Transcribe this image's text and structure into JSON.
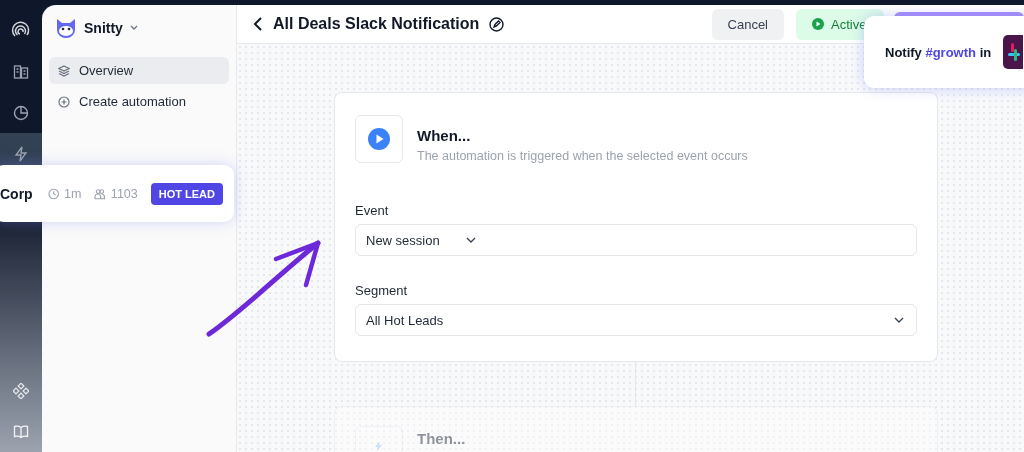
{
  "rail": [
    {
      "kind": "logo",
      "selected": false
    },
    {
      "kind": "building",
      "selected": false
    },
    {
      "kind": "pie",
      "selected": false
    },
    {
      "kind": "bolt",
      "selected": true
    },
    {
      "kind": "nodes",
      "selected": false
    },
    {
      "kind": "book",
      "selected": false
    }
  ],
  "sidebar": {
    "workspace": "Snitty",
    "items": [
      {
        "label": "Overview",
        "selected": true
      },
      {
        "label": "Create automation",
        "selected": false
      }
    ]
  },
  "header": {
    "title": "All Deals Slack Notification",
    "buttons": [
      {
        "kind": "cancel",
        "label": "Cancel"
      },
      {
        "kind": "active",
        "label": "Active"
      }
    ]
  },
  "trigger": {
    "title": "When...",
    "subtitle": "The automation is triggered when the selected event occurs",
    "fields": [
      {
        "label": "Event",
        "value": "New session",
        "kind": "short"
      },
      {
        "label": "Segment",
        "value": "All Hot Leads",
        "kind": "wide"
      }
    ]
  },
  "action": {
    "title": "Then..."
  },
  "lead_card": {
    "name": "Corp",
    "time": "1m",
    "count": "1103",
    "badge": "HOT LEAD"
  },
  "notify_card": {
    "prefix": "Notify",
    "channel": "#growth",
    "suffix": "in"
  }
}
